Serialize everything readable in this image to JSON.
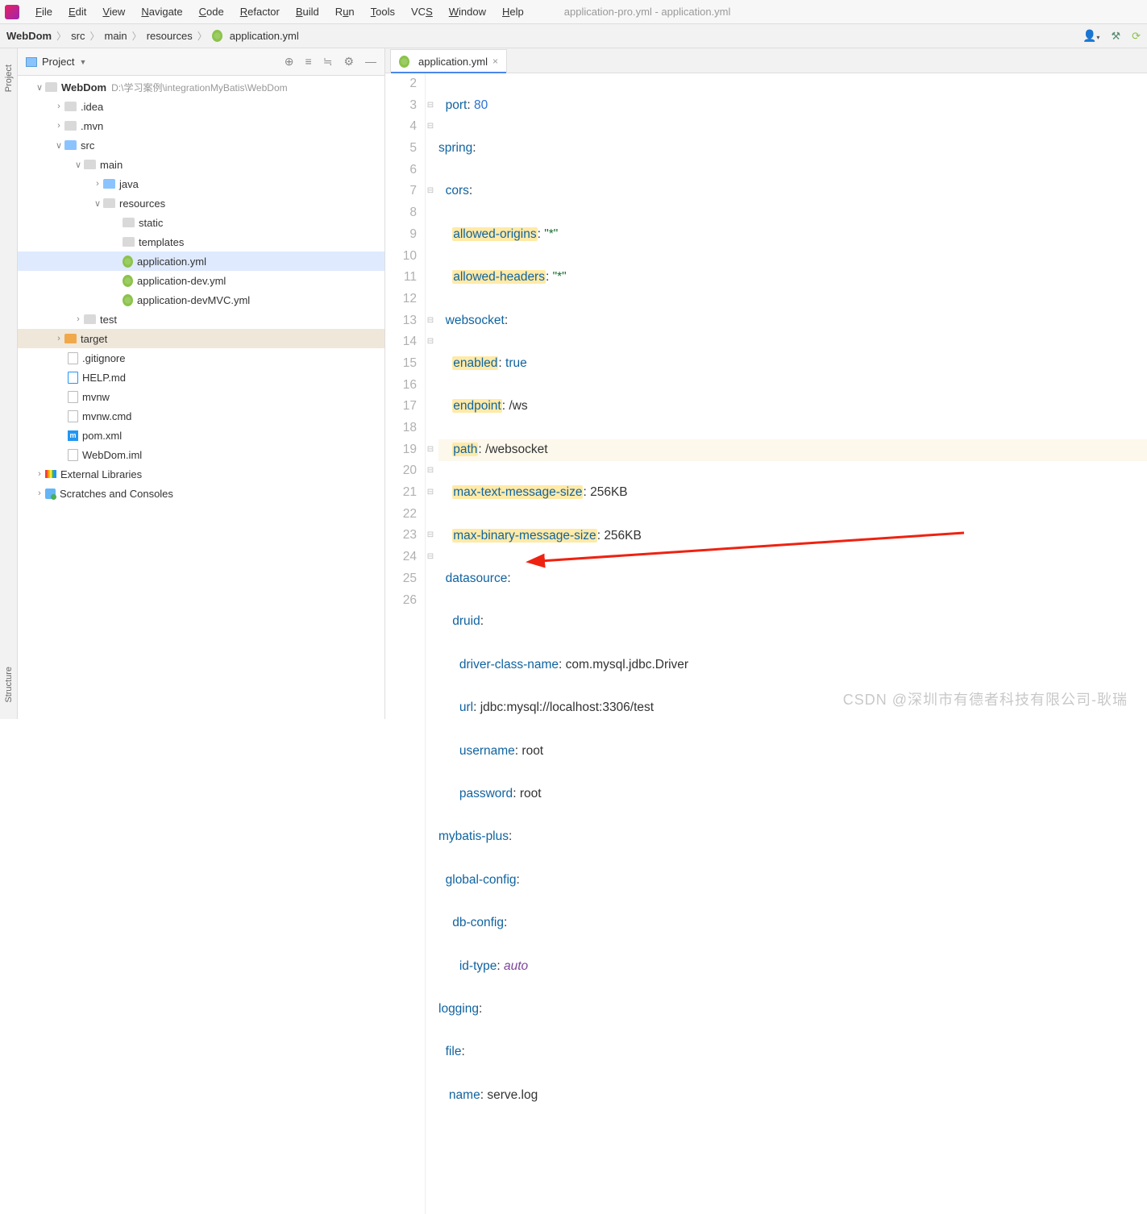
{
  "window_title": "application-pro.yml - application.yml",
  "menu": [
    "File",
    "Edit",
    "View",
    "Navigate",
    "Code",
    "Refactor",
    "Build",
    "Run",
    "Tools",
    "VCS",
    "Window",
    "Help"
  ],
  "breadcrumb": [
    "WebDom",
    "src",
    "main",
    "resources",
    "application.yml"
  ],
  "panel": {
    "title": "Project"
  },
  "tree": {
    "root": {
      "name": "WebDom",
      "path": "D:\\学习案例\\integrationMyBatis\\WebDom"
    },
    "idea": ".idea",
    "mvn": ".mvn",
    "src": "src",
    "main": "main",
    "java": "java",
    "resources": "resources",
    "static": "static",
    "templates": "templates",
    "app_yml": "application.yml",
    "app_dev": "application-dev.yml",
    "app_devmvc": "application-devMVC.yml",
    "test": "test",
    "target": "target",
    "gitignore": ".gitignore",
    "help": "HELP.md",
    "mvnw": "mvnw",
    "mvnwcmd": "mvnw.cmd",
    "pom": "pom.xml",
    "iml": "WebDom.iml",
    "ext_lib": "External Libraries",
    "scratches": "Scratches and Consoles"
  },
  "tab": {
    "name": "application.yml"
  },
  "code": {
    "line_start": 2,
    "line_end": 26,
    "port_val": "80",
    "cors_origins": "\"*\"",
    "cors_headers": "\"*\"",
    "ws_enabled": "true",
    "ws_endpoint": "/ws",
    "ws_path": "/websocket",
    "ws_text_size": "256KB",
    "ws_bin_size": "256KB",
    "driver": "com.mysql.jdbc.Driver",
    "url": "jdbc:mysql://localhost:3306/test",
    "username": "root",
    "password": "root",
    "id_type": "auto",
    "log_name": "serve.log"
  },
  "sidebar_tabs": {
    "project": "Project",
    "structure": "Structure"
  },
  "watermark": "CSDN @深圳市有德者科技有限公司-耿瑞"
}
